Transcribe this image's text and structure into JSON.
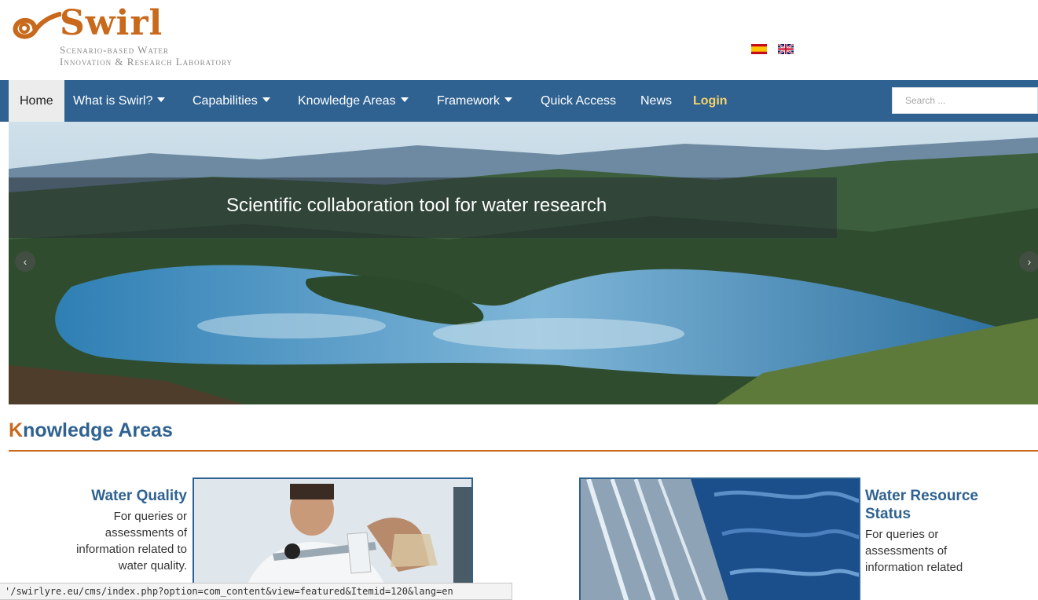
{
  "logo": {
    "word": "Swirl",
    "tagline_line1": "Scenario-based Water",
    "tagline_line2": "Innovation & Research Laboratory"
  },
  "languages": [
    "es-flag-icon",
    "uk-flag-icon"
  ],
  "nav": {
    "home": "Home",
    "what_is": "What is Swirl?",
    "capabilities": "Capabilities",
    "knowledge_areas": "Knowledge Areas",
    "framework": "Framework",
    "quick_access": "Quick Access",
    "news": "News",
    "login": "Login"
  },
  "search": {
    "placeholder": "Search ..."
  },
  "hero": {
    "caption": "Scientific collaboration tool for water research",
    "prev_icon": "chevron-left-icon",
    "next_icon": "chevron-right-icon"
  },
  "section": {
    "title_first": "K",
    "title_rest": "nowledge Areas"
  },
  "cards": [
    {
      "title": "Water Quality",
      "description": "For queries or assessments of information related to water quality."
    },
    {
      "title": "Water Resource Status",
      "description": "For queries or assessments of information related"
    }
  ],
  "statusbar": {
    "url": "'/swirlyre.eu/cms/index.php?option=com_content&view=featured&Itemid=120&lang=en"
  },
  "colors": {
    "brand_blue": "#2f6291",
    "brand_orange": "#c8691c",
    "login_yellow": "#f5d36a"
  }
}
